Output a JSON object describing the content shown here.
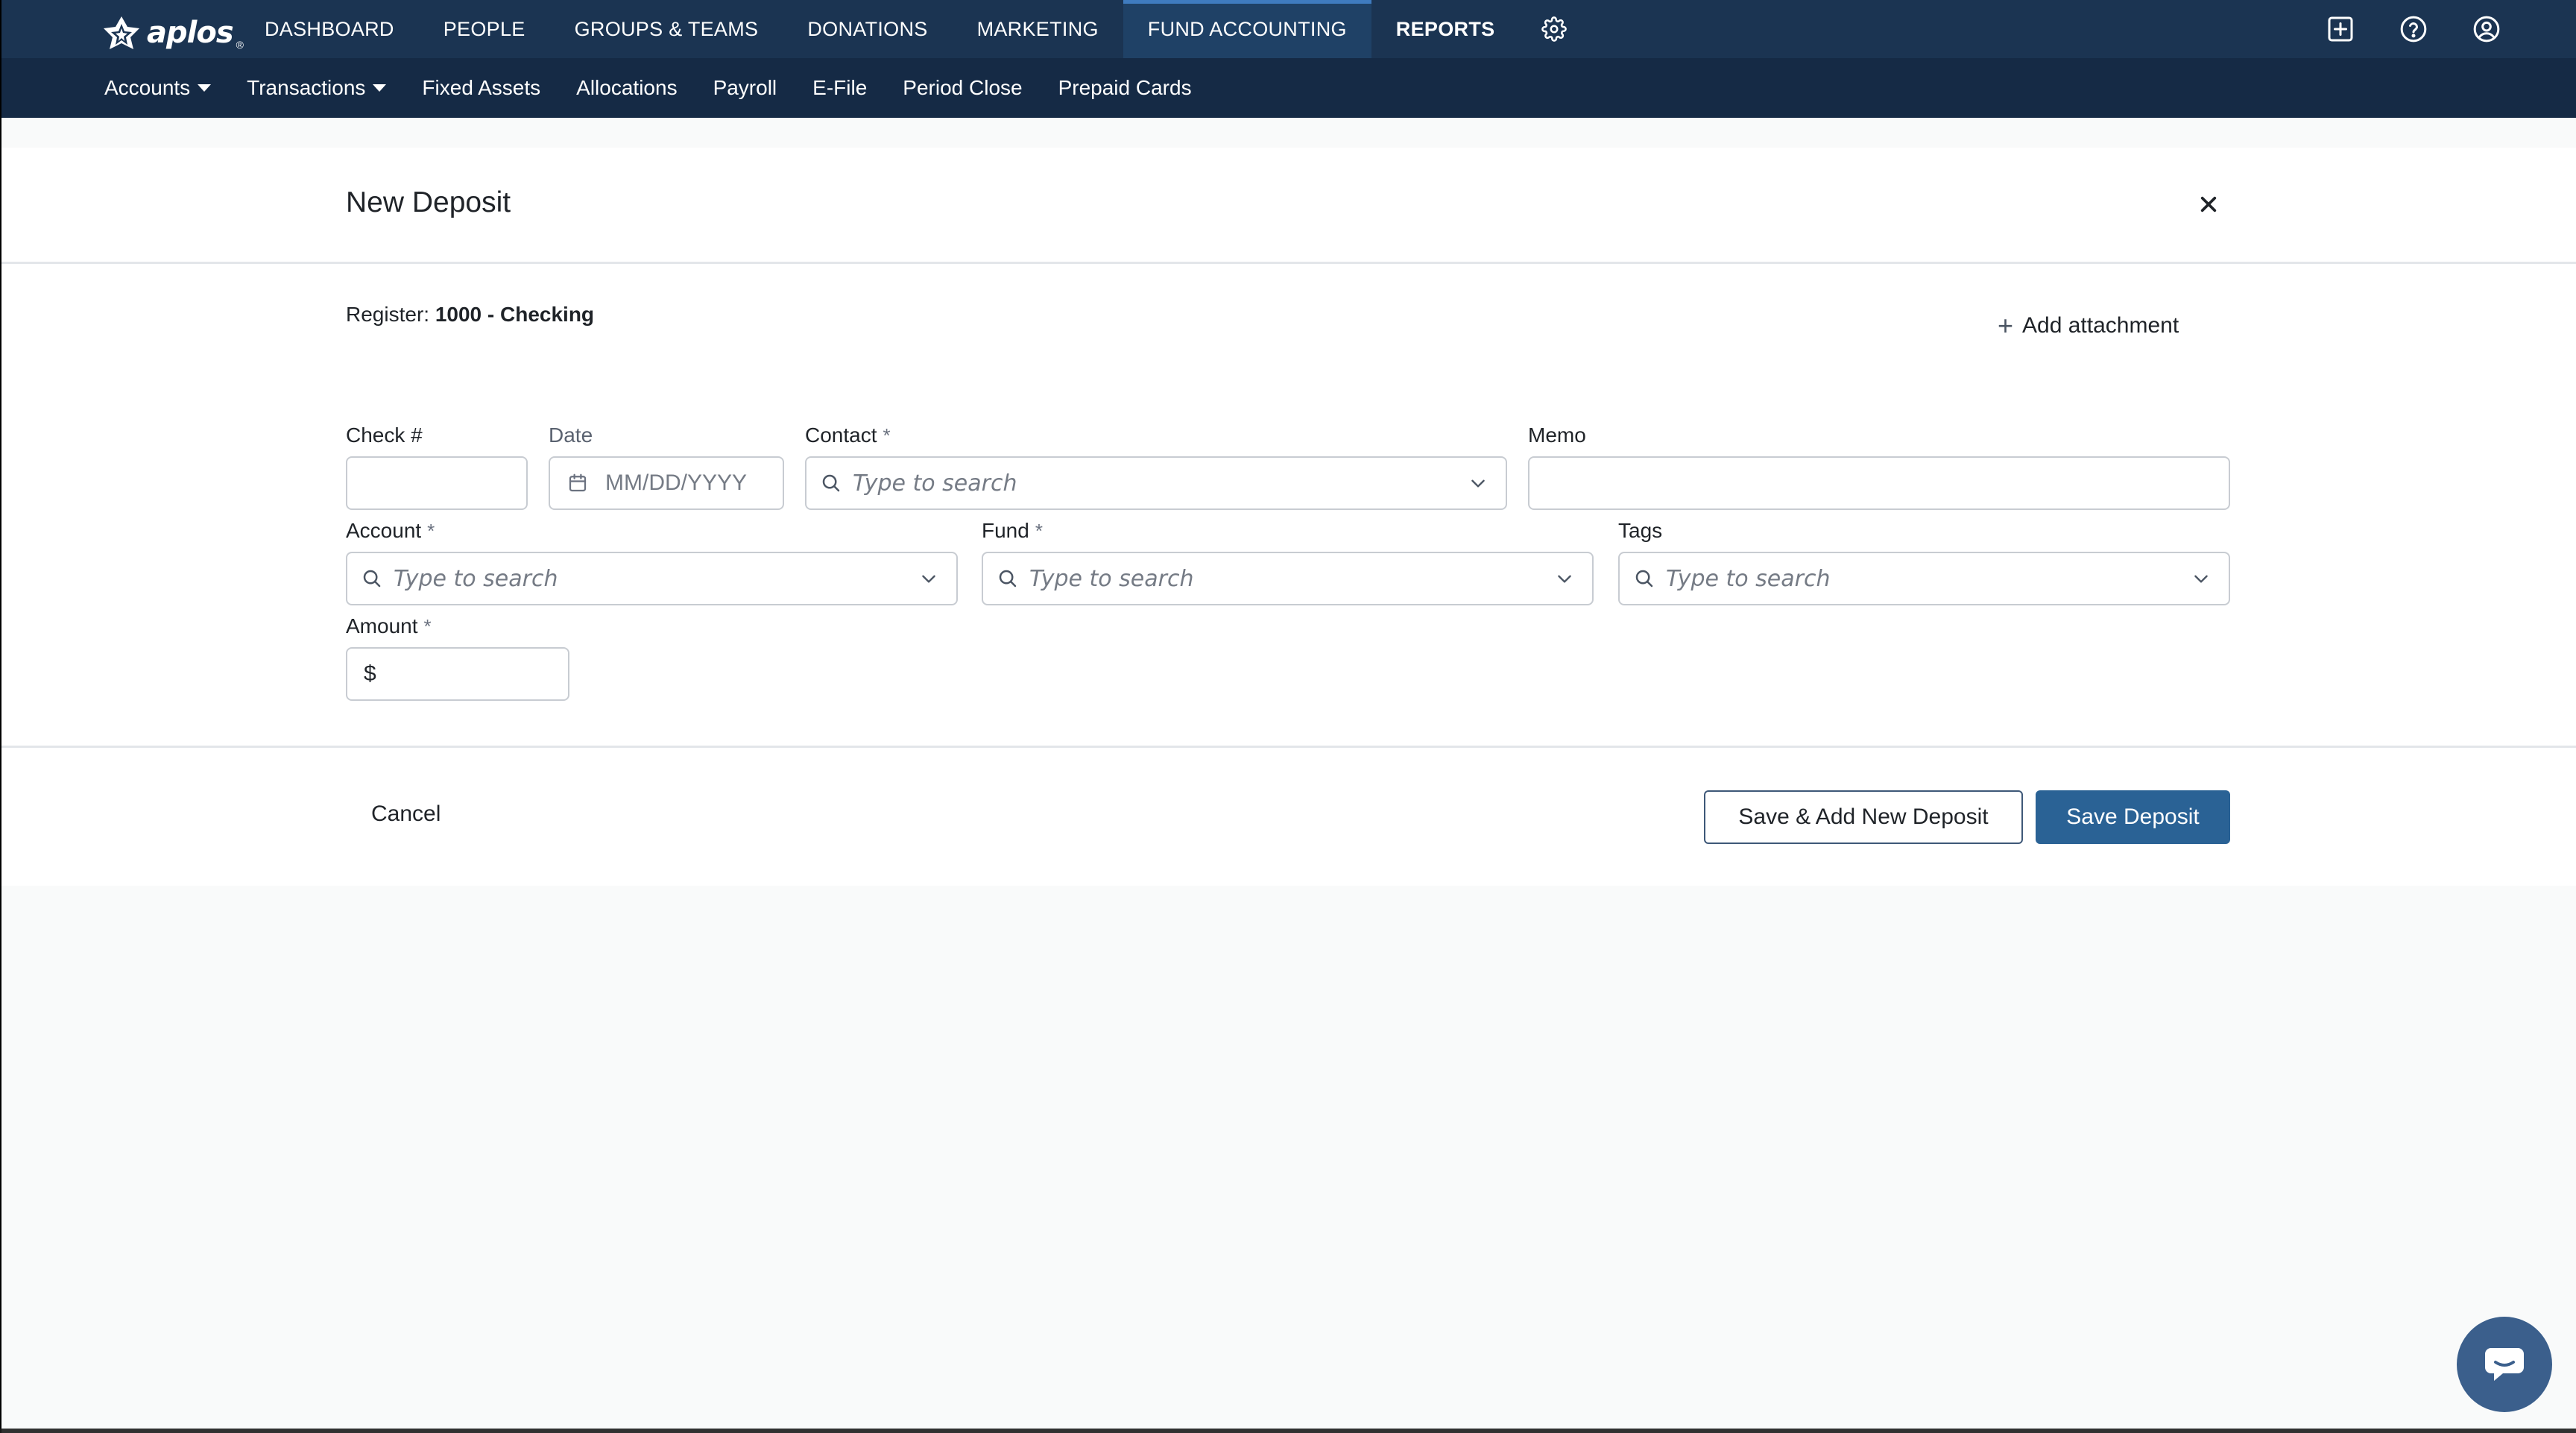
{
  "logo": {
    "text": "aplos",
    "reg": "®"
  },
  "main_nav": [
    {
      "label": "DASHBOARD"
    },
    {
      "label": "PEOPLE"
    },
    {
      "label": "GROUPS & TEAMS"
    },
    {
      "label": "DONATIONS"
    },
    {
      "label": "MARKETING"
    },
    {
      "label": "FUND ACCOUNTING"
    },
    {
      "label": "REPORTS"
    }
  ],
  "main_nav_active": "FUND ACCOUNTING",
  "sub_nav": [
    {
      "label": "Accounts"
    },
    {
      "label": "Transactions"
    },
    {
      "label": "Fixed Assets"
    },
    {
      "label": "Allocations"
    },
    {
      "label": "Payroll"
    },
    {
      "label": "E-File"
    },
    {
      "label": "Period Close"
    },
    {
      "label": "Prepaid Cards"
    }
  ],
  "modal": {
    "title": "New Deposit",
    "register_label": "Register:",
    "register_value": "1000 - Checking",
    "add_attachment": "Add attachment",
    "fields": {
      "check": {
        "label": "Check #",
        "value": ""
      },
      "date": {
        "label": "Date",
        "placeholder": "MM/DD/YYYY"
      },
      "contact": {
        "label": "Contact",
        "required": "*",
        "placeholder": "Type to search"
      },
      "memo": {
        "label": "Memo",
        "value": ""
      },
      "account": {
        "label": "Account",
        "required": "*",
        "placeholder": "Type to search"
      },
      "fund": {
        "label": "Fund",
        "required": "*",
        "placeholder": "Type to search"
      },
      "tags": {
        "label": "Tags",
        "placeholder": "Type to search"
      },
      "amount": {
        "label": "Amount",
        "required": "*",
        "prefix": "$",
        "value": ""
      }
    },
    "cancel": "Cancel",
    "save_add_new": "Save & Add New Deposit",
    "save": "Save Deposit"
  },
  "colors": {
    "topbar": "#1b3452",
    "subbar": "#152a45",
    "primary_button": "#2a6295",
    "chat_bubble": "#3b5f8c"
  },
  "icons": [
    "logo-mark-icon",
    "gear-icon",
    "add-box-icon",
    "help-icon",
    "user-icon",
    "close-icon",
    "plus-icon",
    "calendar-icon",
    "search-icon",
    "chevron-down-icon",
    "chat-icon"
  ]
}
